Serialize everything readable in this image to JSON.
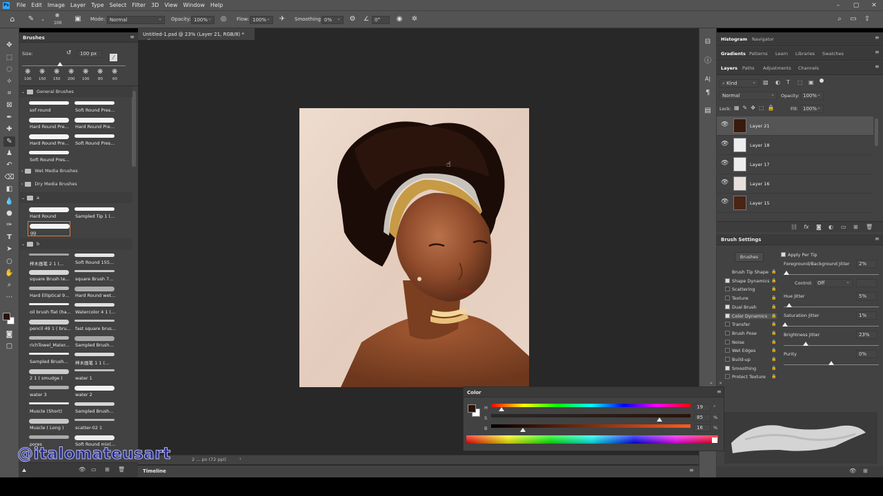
{
  "app": {
    "logo": "Ps"
  },
  "menu": [
    "File",
    "Edit",
    "Image",
    "Layer",
    "Type",
    "Select",
    "Filter",
    "3D",
    "View",
    "Window",
    "Help"
  ],
  "window_controls": [
    "–",
    "▢",
    "✕"
  ],
  "options_bar": {
    "brush_size": "100",
    "mode_label": "Mode:",
    "mode_value": "Normal",
    "opacity_label": "Opacity:",
    "opacity_value": "100%",
    "flow_label": "Flow:",
    "flow_value": "100%",
    "smoothing_label": "Smoothing:",
    "smoothing_value": "0%",
    "angle_value": "0°"
  },
  "brushes_panel": {
    "tab": "Brushes",
    "size_label": "Size:",
    "size_value": "100 px",
    "preset_sizes": [
      "100",
      "150",
      "150",
      "200",
      "100",
      "80",
      "60"
    ],
    "groups": {
      "general": "General Brushes",
      "wet": "Wet Media Brushes",
      "dry": "Dry Media Brushes",
      "a": "a",
      "b": "b"
    },
    "general_items": [
      "sof round",
      "Soft Round Pres...",
      "Hard Round Pre...",
      "Hard Round Pre...",
      "Hard Round Pre...",
      "Soft Round Pres...",
      "Soft Round Pres..."
    ],
    "a_items": [
      "Hard Round",
      "Sampled Tip 1 (...",
      "gg"
    ],
    "b_items": [
      "梓木画笔 2 1 (...",
      "Soft Round 155...",
      "square Brush te...",
      "square Brush 7...",
      "Hard Elliptical 9...",
      "Hard Round wet...",
      "oil brush flat (ha...",
      "Watercolor 4 1 (...",
      "pencil 49 1 ( bru...",
      "fast square brus...",
      "richTowel_Mater...",
      "Sampled Brush...",
      "Sampled Brush...",
      "梓木画笔 1 1 (...",
      "2 1 ( smudge )",
      "water 1",
      "water 3",
      "water 2",
      "Muscle (Short)",
      "Sampled Brush...",
      "Muscle ( Long )",
      "scatter-02 1",
      "pores",
      "Soft Round mix(..."
    ]
  },
  "document": {
    "tab_title": "Untitled-1.psd @ 23% (Layer 21, RGB/8) *",
    "status": "2 ... px (72 ppi)"
  },
  "right_panels": {
    "top_tabs": [
      "Histogram",
      "Navigator"
    ],
    "second_tabs": [
      "Gradients",
      "Patterns",
      "Learn",
      "Libraries",
      "Swatches"
    ],
    "layer_tabs": [
      "Layers",
      "Paths",
      "Adjustments",
      "Channels"
    ],
    "kind_label": "Kind",
    "blend_mode": "Normal",
    "opacity_label": "Opacity:",
    "opacity_value": "100%",
    "lock_label": "Lock:",
    "fill_label": "Fill:",
    "fill_value": "100%",
    "layers": [
      "Layer 21",
      "Layer 18",
      "Layer 17",
      "Layer 16",
      "Layer 15"
    ]
  },
  "brush_settings": {
    "title": "Brush Settings",
    "brushes_button": "Brushes",
    "apply_per_tip": "Apply Per Tip",
    "fb_jitter_label": "Foreground/Background Jitter",
    "fb_jitter_value": "2%",
    "control_label": "Control:",
    "control_value": "Off",
    "hue_label": "Hue Jitter",
    "hue_value": "5%",
    "sat_label": "Saturation Jitter",
    "sat_value": "1%",
    "bright_label": "Brightness Jitter",
    "bright_value": "23%",
    "purity_label": "Purity",
    "purity_value": "0%",
    "items": [
      {
        "label": "Brush Tip Shape",
        "checked": null
      },
      {
        "label": "Shape Dynamics",
        "checked": true
      },
      {
        "label": "Scattering",
        "checked": false
      },
      {
        "label": "Texture",
        "checked": false
      },
      {
        "label": "Dual Brush",
        "checked": true
      },
      {
        "label": "Color Dynamics",
        "checked": true
      },
      {
        "label": "Transfer",
        "checked": false
      },
      {
        "label": "Brush Pose",
        "checked": false
      },
      {
        "label": "Noise",
        "checked": false
      },
      {
        "label": "Wet Edges",
        "checked": false
      },
      {
        "label": "Build-up",
        "checked": false
      },
      {
        "label": "Smoothing",
        "checked": true
      },
      {
        "label": "Protect Texture",
        "checked": false
      }
    ]
  },
  "color_panel": {
    "title": "Color",
    "h_label": "H",
    "h_value": "19",
    "h_unit": "°",
    "s_label": "S",
    "s_value": "85",
    "s_unit": "%",
    "b_label": "B",
    "b_value": "16",
    "b_unit": "%",
    "foreground": "#2a130a",
    "background": "#ffffff"
  },
  "timeline": {
    "label": "Timeline"
  },
  "watermark": "@italomateusart"
}
